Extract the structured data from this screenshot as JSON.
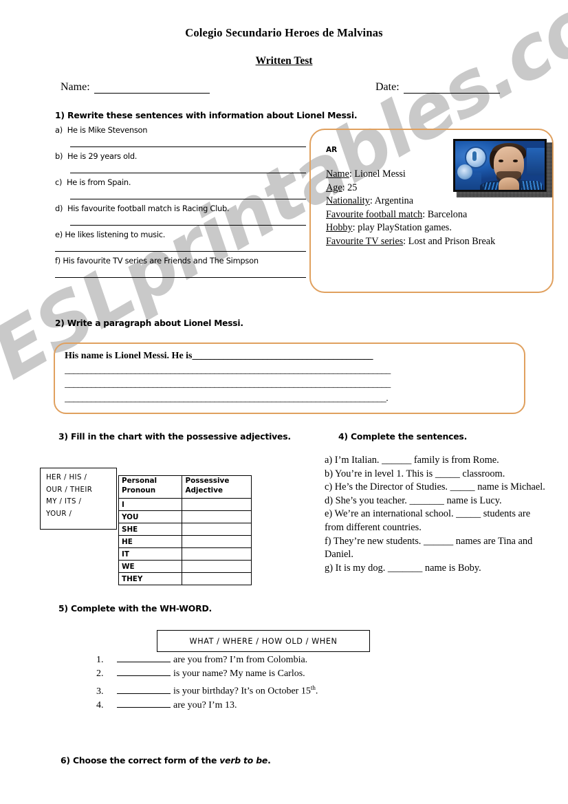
{
  "document": {
    "school_title": "Colegio Secundario Heroes de Malvinas",
    "test_title": "Written Test",
    "name_label": "Name:",
    "date_label": "Date:"
  },
  "watermark": {
    "text": "ESLprintables.com",
    "color": "#c9c9c9"
  },
  "theme": {
    "box_border_color": "#e0a05e",
    "text_color": "#000000"
  },
  "exercise1": {
    "heading": "1) Rewrite these sentences with information about Lionel Messi.",
    "items": [
      {
        "label": "a)",
        "text": "He is Mike Stevenson"
      },
      {
        "label": "b)",
        "text": "He is 29 years old."
      },
      {
        "label": "c)",
        "text": "He is from Spain."
      },
      {
        "label": "d)",
        "text": "His favourite football match is Racing Club."
      },
      {
        "label": "e)",
        "text": "He likes listening to music."
      },
      {
        "label": "f)",
        "text": "His favourite TV series are Friends and The Simpson"
      }
    ]
  },
  "info_card": {
    "tag": "AR",
    "photo_alt": "lionel-messi-photo",
    "fields": [
      {
        "label": "Name",
        "value": "Lionel Messi"
      },
      {
        "label": "Age",
        "value": "25"
      },
      {
        "label": "Nationality",
        "value": "Argentina"
      },
      {
        "label": "Favourite football match",
        "value": "Barcelona"
      },
      {
        "label": "Hobby",
        "value": "play PlayStation games."
      },
      {
        "label": "Favourite TV series",
        "value": "Lost and Prison Break"
      }
    ]
  },
  "exercise2": {
    "heading": "2) Write a paragraph about Lionel Messi.",
    "starter": "His name is Lionel Messi. He is",
    "line1_rule": "_________________________________________",
    "line2_rule": "__________________________________________________________________________",
    "line3_rule": "__________________________________________________________________________",
    "line4_rule": "_________________________________________________________________________."
  },
  "exercise3": {
    "heading": "3) Fill in the chart with the possessive adjectives.",
    "word_bank": [
      "HER  /   HIS  /",
      "OUR   / THEIR",
      "MY  /  ITS   /",
      "YOUR  /"
    ],
    "table": {
      "headers": [
        "Personal Pronoun",
        "Possessive Adjective"
      ],
      "header_col1_line1": "Personal",
      "header_col1_line2": "Pronoun",
      "header_col2_line1": "Possessive",
      "header_col2_line2": "Adjective",
      "rows": [
        {
          "pronoun": "I",
          "adjective": ""
        },
        {
          "pronoun": "YOU",
          "adjective": ""
        },
        {
          "pronoun": "SHE",
          "adjective": ""
        },
        {
          "pronoun": "HE",
          "adjective": ""
        },
        {
          "pronoun": "IT",
          "adjective": ""
        },
        {
          "pronoun": "WE",
          "adjective": ""
        },
        {
          "pronoun": "THEY",
          "adjective": ""
        }
      ]
    }
  },
  "exercise4": {
    "heading": "4) Complete the sentences.",
    "items": [
      "a) I’m Italian. ______ family is from Rome.",
      "b) You’re in level 1. This is _____ classroom.",
      "c) He’s the Director of Studies. _____ name is Michael.",
      "d) She’s you teacher. _______ name is Lucy.",
      "e) We’re an international school. _____ students are from different countries.",
      "f) They’re new students. ______ names are Tina and Daniel.",
      "g) It is my dog. _______ name is Boby."
    ]
  },
  "exercise5": {
    "heading": "5) Complete with the WH-WORD.",
    "word_box": "WHAT  /  WHERE  /  HOW OLD  /  WHEN",
    "items": [
      {
        "number": "1.",
        "text": "are you from?   I’m from Colombia.",
        "suffix": ""
      },
      {
        "number": "2.",
        "text": "is your name?  My name is Carlos.",
        "suffix": ""
      },
      {
        "number": "3.",
        "text": "is your birthday? It’s on October 15",
        "suffix": "th",
        "tail": "."
      },
      {
        "number": "4.",
        "text": "are you? I’m 13.",
        "suffix": ""
      }
    ]
  },
  "exercise6": {
    "heading_prefix": "6) Choose the correct form of the ",
    "heading_italic": "verb to be",
    "heading_suffix": "."
  }
}
